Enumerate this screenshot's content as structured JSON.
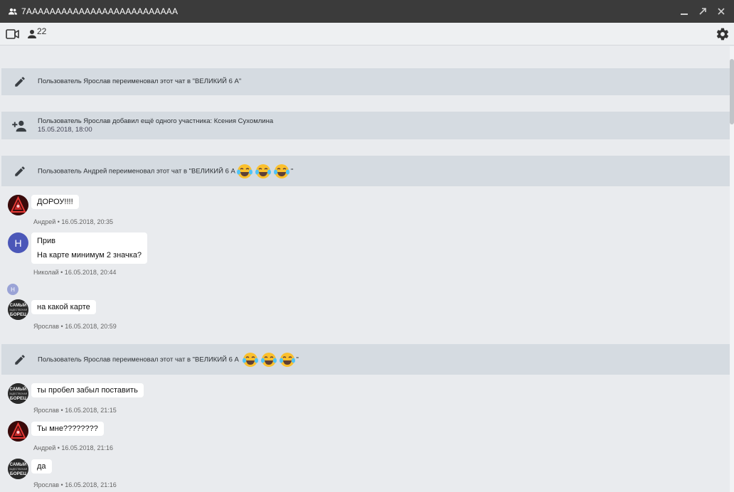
{
  "window": {
    "title": "7AAAAAAAAAAAAAAAAAAAAAAAAAA"
  },
  "toolbar": {
    "members_count": "22"
  },
  "messages": [
    {
      "type": "system",
      "text": "Пользователь Ярослав переименовал этот чат в \"ВЕЛИКИЙ  6 А\""
    },
    {
      "type": "system",
      "text": "Пользователь Ярослав добавил ещё одного участника: Ксения Сухомлина",
      "time": "15.05.2018, 18:00"
    },
    {
      "type": "system",
      "text": "Пользователь Андрей переименовал этот чат в \"ВЕЛИКИЙ  6 А",
      "tail": "\""
    },
    {
      "type": "message",
      "lines": [
        "ДОРОУ!!!!"
      ],
      "meta": "Андрей • 16.05.2018, 20:35"
    },
    {
      "type": "message",
      "avatar_letter": "Н",
      "lines": [
        "Прив",
        "На карте минимум 2 значка?"
      ],
      "meta": "Николай • 16.05.2018, 20:44"
    },
    {
      "type": "read-marker",
      "avatar_letter": "Н"
    },
    {
      "type": "message",
      "lines": [
        "на какой карте"
      ],
      "meta": "Ярослав • 16.05.2018, 20:59"
    },
    {
      "type": "system",
      "text": "Пользователь Ярослав переименовал этот чат в \"ВЕЛИКИЙ  6 А",
      "tail": "\""
    },
    {
      "type": "message",
      "lines": [
        "ты пробел забыл поставить"
      ],
      "meta": "Ярослав • 16.05.2018, 21:15"
    },
    {
      "type": "message",
      "lines": [
        "Ты мне????????"
      ],
      "meta": "Андрей • 16.05.2018, 21:16"
    },
    {
      "type": "message",
      "lines": [
        "да"
      ],
      "meta": "Ярослав • 16.05.2018, 21:16"
    }
  ],
  "avatar_logo_text": [
    "САМЫЙ",
    "ЗАДЕСТВОНАЯ",
    "БОРЕЦ"
  ],
  "colors": {
    "titlebar": "#3b3b3b",
    "system_bg": "#d5dbe1",
    "feed_bg": "#e9ebee",
    "avatar_letter_bg": "#4b57b8"
  }
}
